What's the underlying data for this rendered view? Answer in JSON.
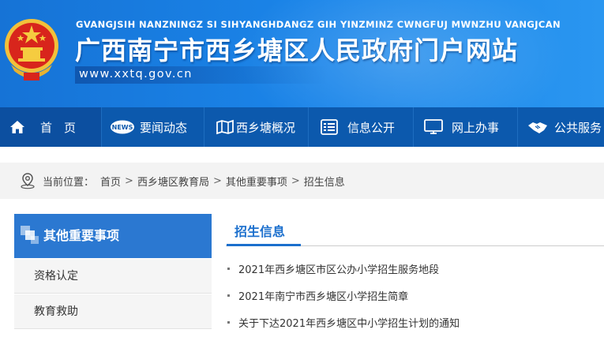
{
  "header": {
    "pinyin": "GVANGJSIH NANZNINGZ SI SIHYANGHDANGZ GIH YINZMINZ CWNGFUJ MWNZHU VANGJCAN",
    "title": "广西南宁市西乡塘区人民政府门户网站",
    "url": "www.xxtq.gov.cn"
  },
  "nav": [
    {
      "label": "首　页",
      "icon": "home-icon"
    },
    {
      "label": "要闻动态",
      "icon": "news-icon"
    },
    {
      "label": "西乡塘概况",
      "icon": "map-icon"
    },
    {
      "label": "信息公开",
      "icon": "document-list-icon"
    },
    {
      "label": "网上办事",
      "icon": "monitor-icon"
    },
    {
      "label": "公共服务",
      "icon": "handshake-icon"
    }
  ],
  "breadcrumb": {
    "prefix": "当前位置：",
    "items": [
      "首页",
      "西乡塘区教育局",
      "其他重要事项",
      "招生信息"
    ],
    "separator": ">"
  },
  "sidebar": {
    "title": "其他重要事项",
    "items": [
      {
        "label": "资格认定"
      },
      {
        "label": "教育救助"
      }
    ]
  },
  "main": {
    "tab": "招生信息",
    "articles": [
      {
        "title": "2021年西乡塘区市区公办小学招生服务地段"
      },
      {
        "title": "2021年南宁市西乡塘区小学招生简章"
      },
      {
        "title": "关于下达2021年西乡塘区中小学招生计划的通知"
      }
    ]
  },
  "colors": {
    "banner": "#1b86ea",
    "nav": "#0c59ad",
    "accent": "#1b6fcd",
    "sidebar_head": "#2b78d1"
  }
}
